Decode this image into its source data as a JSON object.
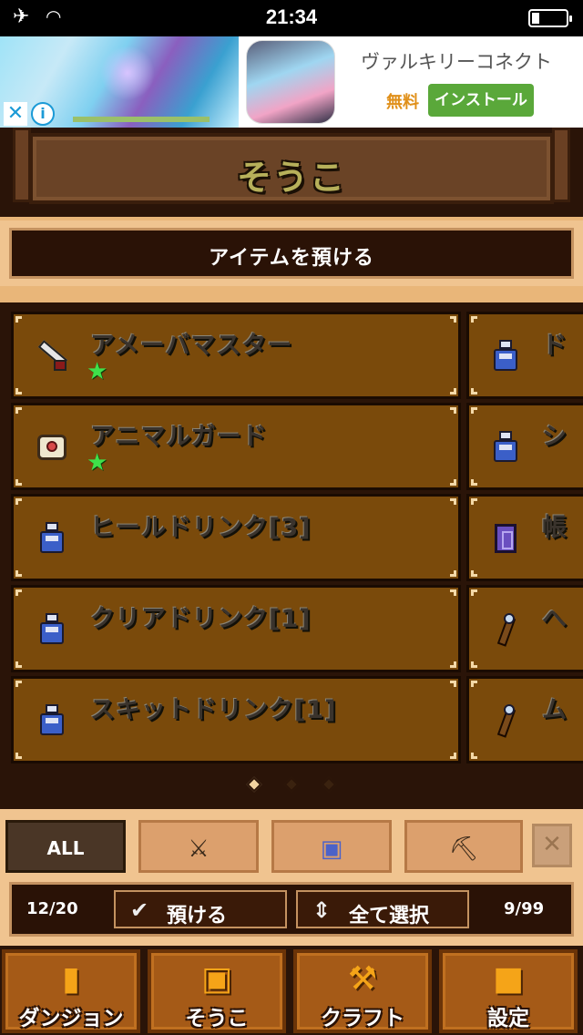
{
  "status_bar": {
    "time": "21:34",
    "icons": [
      "airplane-icon",
      "wifi-icon",
      "battery-icon"
    ]
  },
  "ad": {
    "title": "ヴァルキリーコネクト",
    "price": "無料",
    "install_label": "インストール",
    "close_glyph": "✕",
    "info_glyph": "i"
  },
  "header": {
    "title": "そうこ"
  },
  "deposit_banner": {
    "label": "アイテムを預ける"
  },
  "items_left": [
    {
      "name": "アメーバマスター",
      "icon": "sword-icon",
      "starred": true
    },
    {
      "name": "アニマルガード",
      "icon": "shield-icon",
      "starred": true
    },
    {
      "name": "ヒールドリンク[3]",
      "icon": "potion-icon",
      "starred": false
    },
    {
      "name": "クリアドリンク[1]",
      "icon": "potion-icon",
      "starred": false
    },
    {
      "name": "スキットドリンク[1]",
      "icon": "potion-icon",
      "starred": false
    }
  ],
  "items_right": [
    {
      "name": "ド",
      "icon": "potion-icon"
    },
    {
      "name": "シ",
      "icon": "potion-icon"
    },
    {
      "name": "帳",
      "icon": "book-icon"
    },
    {
      "name": "へ",
      "icon": "wand-icon"
    },
    {
      "name": "ム",
      "icon": "wand-icon"
    }
  ],
  "star_glyph": "★",
  "pager": {
    "pages": 3,
    "current": 1
  },
  "filters": [
    {
      "label": "ALL",
      "icon": "",
      "active": true
    },
    {
      "label": "",
      "icon": "equipment-icon",
      "active": false
    },
    {
      "label": "",
      "icon": "consumables-icon",
      "active": false
    },
    {
      "label": "",
      "icon": "materials-icon",
      "active": false
    }
  ],
  "filter_icon_glyphs": {
    "equipment": "⚔",
    "consumables": "▣",
    "materials": "⛏"
  },
  "filter_close_glyph": "✕",
  "actions": {
    "left_count": "12/20",
    "deposit_label": "預ける",
    "deposit_glyph": "✔",
    "select_all_label": "全て選択",
    "select_all_glyph": "⇕",
    "right_count": "9/99"
  },
  "nav": [
    {
      "label": "ダンジョン",
      "icon": "dungeon-icon",
      "glyph": "▮"
    },
    {
      "label": "そうこ",
      "icon": "storage-icon",
      "glyph": "▣"
    },
    {
      "label": "クラフト",
      "icon": "craft-icon",
      "glyph": "⚒"
    },
    {
      "label": "設定",
      "icon": "settings-icon",
      "glyph": "■"
    }
  ],
  "colors": {
    "card_bg": "#7a4a0b",
    "panel_tan": "#f0c490",
    "dark_bg": "#2a1408",
    "star_green": "#3fe04a",
    "install_green": "#5aa83a",
    "nav_orange": "#a55a17"
  }
}
